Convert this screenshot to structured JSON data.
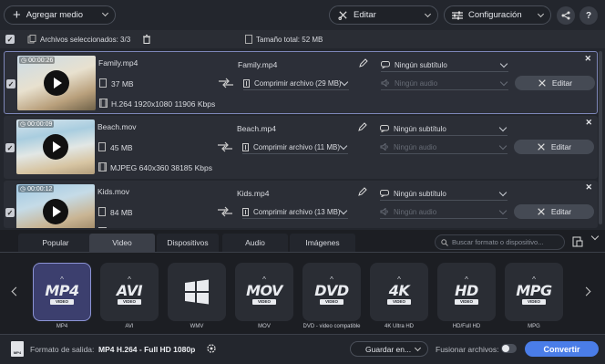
{
  "toolbar": {
    "add_media": "Agregar medio",
    "edit": "Editar",
    "settings": "Configuración",
    "help": "?"
  },
  "selection": {
    "label": "Archivos seleccionados: 3/3",
    "total_size": "Tamaño total: 52 MB"
  },
  "files": [
    {
      "duration": "00:00:26",
      "name": "Family.mp4",
      "size": "37 MB",
      "meta": "H.264 1920x1080 11906 Kbps",
      "output": "Family.mp4",
      "compress": "Comprimir archivo (29 MB)",
      "subtitle": "Ningún subtítulo",
      "audio": "Ningún audio",
      "edit": "Editar"
    },
    {
      "duration": "00:00:09",
      "name": "Beach.mov",
      "size": "45 MB",
      "meta": "MJPEG 640x360 38185 Kbps",
      "output": "Beach.mp4",
      "compress": "Comprimir archivo (11 MB)",
      "subtitle": "Ningún subtítulo",
      "audio": "Ningún audio",
      "edit": "Editar"
    },
    {
      "duration": "00:00:12",
      "name": "Kids.mov",
      "size": "84 MB",
      "meta": "",
      "output": "Kids.mp4",
      "compress": "Comprimir archivo (13 MB)",
      "subtitle": "Ningún subtítulo",
      "audio": "Ningún audio",
      "edit": "Editar"
    }
  ],
  "tabs": [
    "Popular",
    "Video",
    "Dispositivos",
    "Audio",
    "Imágenes"
  ],
  "active_tab": "Video",
  "format_search": {
    "placeholder": "Buscar formato o dispositivo..."
  },
  "formats": [
    {
      "big": "MP4",
      "sub": "VIDEO",
      "label": "MP4"
    },
    {
      "big": "AVI",
      "sub": "VIDEO",
      "label": "AVI"
    },
    {
      "big": "",
      "sub": "",
      "label": "WMV"
    },
    {
      "big": "MOV",
      "sub": "VIDEO",
      "label": "MOV"
    },
    {
      "big": "DVD",
      "sub": "VIDEO",
      "label": "DVD - video compatible"
    },
    {
      "big": "4K",
      "sub": "VIDEO",
      "label": "4K Ultra HD"
    },
    {
      "big": "HD",
      "sub": "VIDEO",
      "label": "HD/Full HD"
    },
    {
      "big": "MPG",
      "sub": "VIDEO",
      "label": "MPG"
    }
  ],
  "bottom": {
    "output_label": "Formato de salida:",
    "output_value": "MP4 H.264 - Full HD 1080p",
    "save": "Guardar en...",
    "merge": "Fusionar archivos:",
    "convert": "Convertir"
  },
  "colors": {
    "accent": "#4a7de8",
    "selected_border": "#7d86b8"
  }
}
